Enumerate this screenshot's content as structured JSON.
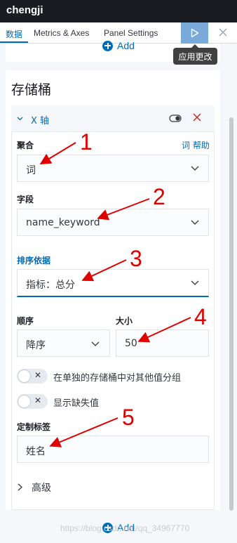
{
  "app": {
    "title": "chengji"
  },
  "tabs": [
    {
      "label": "数据",
      "active": true
    },
    {
      "label": "Metrics & Axes",
      "active": false
    },
    {
      "label": "Panel Settings",
      "active": false
    }
  ],
  "toolbar": {
    "apply_icon": "play-icon",
    "close_icon": "close-icon",
    "apply_tooltip": "应用更改"
  },
  "add_label": "Add",
  "buckets": {
    "title": "存储桶",
    "agg_title": "X 轴",
    "aggregation": {
      "label": "聚合",
      "help": "词 帮助",
      "value": "词"
    },
    "field": {
      "label": "字段",
      "value": "name_keyword"
    },
    "order_by": {
      "label": "排序依据",
      "value": "指标：总分"
    },
    "order": {
      "label": "顺序",
      "value": "降序"
    },
    "size": {
      "label": "大小",
      "value": "50"
    },
    "switches": [
      {
        "label": "在单独的存储桶中对其他值分组",
        "on": false
      },
      {
        "label": "显示缺失值",
        "on": false
      }
    ],
    "custom_label": {
      "label": "定制标签",
      "value": "姓名"
    },
    "advanced": "高级"
  },
  "annotations": [
    "1",
    "2",
    "3",
    "4",
    "5"
  ],
  "colors": {
    "accent": "#006bb4",
    "header": "#1a1c21",
    "annotation": "#e00000",
    "danger": "#bd271e"
  },
  "watermark": "https://blog.csdn.net/qq_34967770"
}
